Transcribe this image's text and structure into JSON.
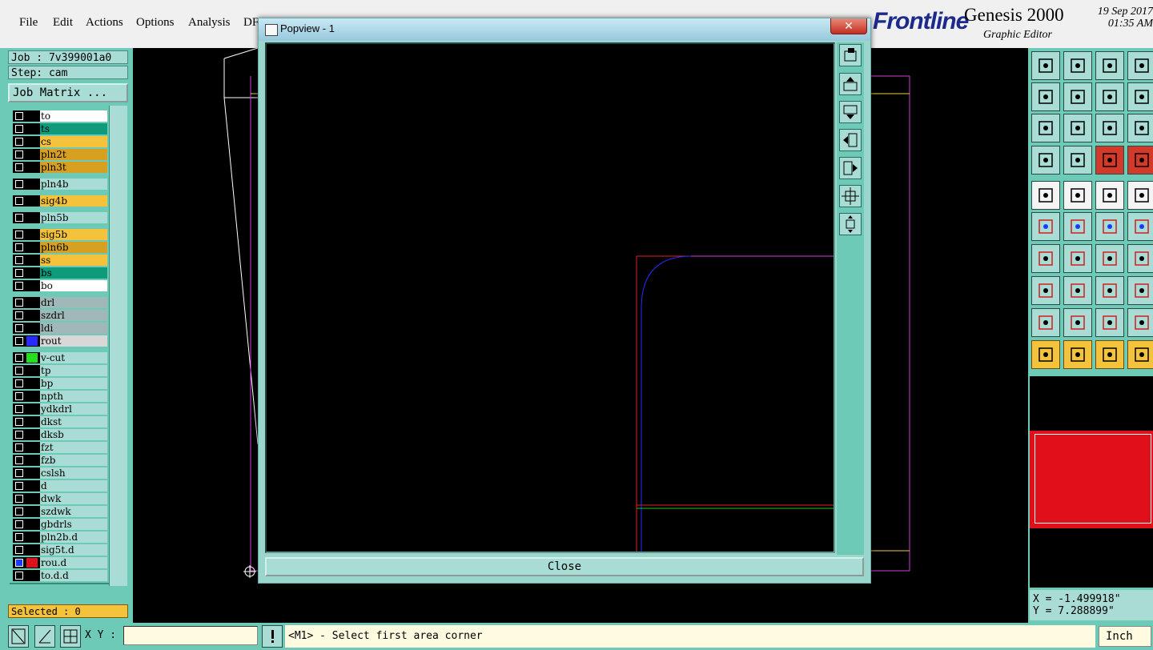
{
  "menu": {
    "items": [
      {
        "label": "File"
      },
      {
        "label": "Edit"
      },
      {
        "label": "Actions"
      },
      {
        "label": "Options"
      },
      {
        "label": "Analysis"
      },
      {
        "label": "DF"
      }
    ]
  },
  "brand": {
    "logo": "Frontline",
    "product": "Genesis 2000",
    "subtitle": "Graphic Editor",
    "date": "19 Sep 2017",
    "time": "01:35 AM"
  },
  "job": {
    "label": "Job : 7v399001a0",
    "step": "Step: cam",
    "matrix_button": "Job Matrix ..."
  },
  "layers": [
    {
      "name": "to",
      "color": "#ffffff",
      "checked": false,
      "swatch": ""
    },
    {
      "name": "ts",
      "color": "#0f9a7c",
      "checked": false,
      "swatch": ""
    },
    {
      "name": "cs",
      "color": "#f5c23c",
      "checked": false,
      "swatch": ""
    },
    {
      "name": "pln2t",
      "color": "#d8a020",
      "checked": false,
      "swatch": ""
    },
    {
      "name": "pln3t",
      "color": "#d8a020",
      "checked": false,
      "swatch": ""
    },
    {
      "name": "pln4b",
      "color": "#a8dcd4",
      "checked": false,
      "swatch": ""
    },
    {
      "name": "sig4b",
      "color": "#f5c23c",
      "checked": false,
      "swatch": ""
    },
    {
      "name": "pln5b",
      "color": "#a8dcd4",
      "checked": false,
      "swatch": ""
    },
    {
      "name": "sig5b",
      "color": "#f5c23c",
      "checked": false,
      "swatch": ""
    },
    {
      "name": "pln6b",
      "color": "#d8a020",
      "checked": false,
      "swatch": ""
    },
    {
      "name": "ss",
      "color": "#f5c23c",
      "checked": false,
      "swatch": ""
    },
    {
      "name": "bs",
      "color": "#0f9a7c",
      "checked": false,
      "swatch": ""
    },
    {
      "name": "bo",
      "color": "#ffffff",
      "checked": false,
      "swatch": ""
    },
    {
      "name": "drl",
      "color": "#a0b8b8",
      "checked": false,
      "swatch": ""
    },
    {
      "name": "szdrl",
      "color": "#a0b8b8",
      "checked": false,
      "swatch": ""
    },
    {
      "name": "ldi",
      "color": "#a0b8b8",
      "checked": false,
      "swatch": ""
    },
    {
      "name": "rout",
      "color": "#d8d8d8",
      "checked": false,
      "swatch": "#2a2aff"
    },
    {
      "name": "v-cut",
      "color": "#a8dcd4",
      "checked": false,
      "swatch": "#22e01a"
    },
    {
      "name": "tp",
      "color": "#a8dcd4",
      "checked": false,
      "swatch": ""
    },
    {
      "name": "bp",
      "color": "#a8dcd4",
      "checked": false,
      "swatch": ""
    },
    {
      "name": "npth",
      "color": "#a8dcd4",
      "checked": false,
      "swatch": ""
    },
    {
      "name": "ydkdrl",
      "color": "#a8dcd4",
      "checked": false,
      "swatch": ""
    },
    {
      "name": "dkst",
      "color": "#a8dcd4",
      "checked": false,
      "swatch": ""
    },
    {
      "name": "dksb",
      "color": "#a8dcd4",
      "checked": false,
      "swatch": ""
    },
    {
      "name": "fzt",
      "color": "#a8dcd4",
      "checked": false,
      "swatch": ""
    },
    {
      "name": "fzb",
      "color": "#a8dcd4",
      "checked": false,
      "swatch": ""
    },
    {
      "name": "cslsh",
      "color": "#a8dcd4",
      "checked": false,
      "swatch": ""
    },
    {
      "name": "d",
      "color": "#a8dcd4",
      "checked": false,
      "swatch": ""
    },
    {
      "name": "dwk",
      "color": "#a8dcd4",
      "checked": false,
      "swatch": ""
    },
    {
      "name": "szdwk",
      "color": "#a8dcd4",
      "checked": false,
      "swatch": ""
    },
    {
      "name": "gbdrls",
      "color": "#a8dcd4",
      "checked": false,
      "swatch": ""
    },
    {
      "name": "pln2b.d",
      "color": "#a8dcd4",
      "checked": false,
      "swatch": ""
    },
    {
      "name": "sig5t.d",
      "color": "#a8dcd4",
      "checked": false,
      "swatch": ""
    },
    {
      "name": "rou.d",
      "color": "#a8dcd4",
      "checked": true,
      "swatch": "#e0101a"
    },
    {
      "name": "to.d.d",
      "color": "#a8dcd4",
      "checked": false,
      "swatch": ""
    }
  ],
  "selected": "Selected : 0",
  "popup": {
    "title": "Popview - 1",
    "close_x": "✕",
    "close_button": "Close"
  },
  "coords": {
    "x": "X = -1.499918\"",
    "y": "Y = 7.288899\""
  },
  "bottom": {
    "xy_label": "X Y :",
    "xy_value": "",
    "status": "<M1> - Select first area corner",
    "units": "Inch"
  },
  "colors": {
    "panel": "#6ccab6",
    "button": "#a8dcd4",
    "accent_red": "#e0101a",
    "accent_orange": "#f5c23c"
  }
}
